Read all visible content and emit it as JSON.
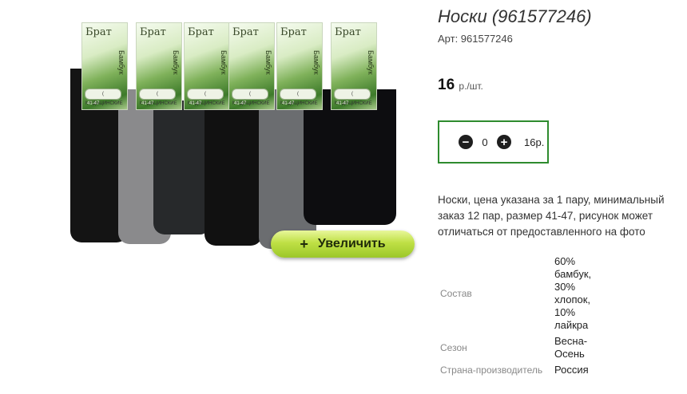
{
  "product": {
    "title": "Носки (961577246)",
    "sku_label": "Арт: 961577246",
    "price_value": "16",
    "price_unit": "р./шт.",
    "quantity": "0",
    "sum": "16р.",
    "description": "Носки, цена указана за 1 пару, минимальный заказ 12 пар, размер 41-47, рисунок может отличаться от предоставленного на фото"
  },
  "image": {
    "zoom_label": "Увеличить",
    "zoom_icon": "+",
    "label_brand": "Брат",
    "label_side": "Бамбук",
    "label_tag": "( МЕДИЦИНСКИЕ",
    "label_size": "41-47",
    "sock_colors": [
      "#141414",
      "#8a8a8c",
      "#27292b",
      "#111111",
      "#6b6d70",
      "#0d0d10"
    ]
  },
  "properties": [
    {
      "key": "Состав",
      "value": "60% бамбук, 30% хлопок, 10% лайкра"
    },
    {
      "key": "Сезон",
      "value": "Весна-Осень"
    },
    {
      "key": "Страна-производитель",
      "value": "Россия"
    }
  ],
  "icons": {
    "minus": "minus-circle-icon",
    "plus": "plus-circle-icon",
    "zoom": "plus-icon"
  },
  "colors": {
    "accent_border": "#2e8b2e",
    "zoom_button": "#bfe045"
  }
}
